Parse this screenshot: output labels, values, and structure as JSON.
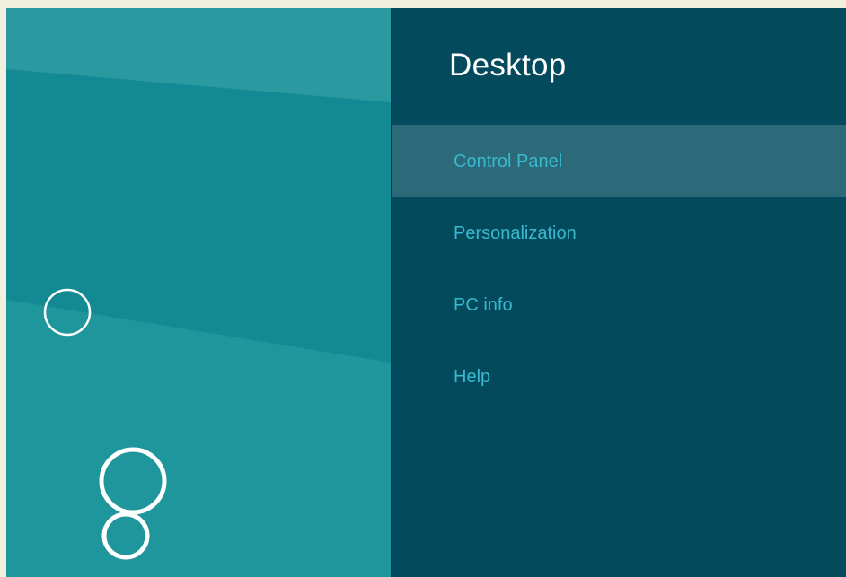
{
  "charms_panel": {
    "title": "Desktop",
    "items": [
      {
        "label": "Control Panel",
        "selected": true
      },
      {
        "label": "Personalization",
        "selected": false
      },
      {
        "label": "PC info",
        "selected": false
      },
      {
        "label": "Help",
        "selected": false
      }
    ]
  },
  "colors": {
    "wallpaper": "#138a93",
    "panel_background": "#034a5d",
    "selected_item": "#2c6a79",
    "item_text": "#39b9cf",
    "title_text": "#ffffff"
  }
}
